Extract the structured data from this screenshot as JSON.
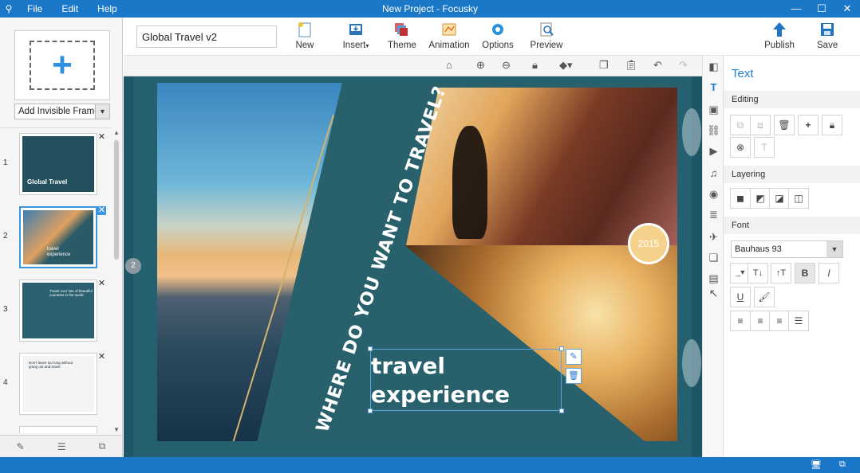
{
  "window": {
    "title": "New Project - Focusky",
    "menu": [
      "File",
      "Edit",
      "Help"
    ],
    "controls": [
      "—",
      "☐",
      "✕"
    ]
  },
  "left_panel": {
    "add_frame_icon": "plus-icon",
    "frame_select_value": "Add Invisible Frame",
    "thumbnails": [
      {
        "number": "1",
        "caption": "Global Travel"
      },
      {
        "number": "2",
        "caption": "travel experience"
      },
      {
        "number": "3",
        "caption": "Travel over lots of beautiful countries in the world"
      },
      {
        "number": "4",
        "caption": "Don't leave too long without going out and travel"
      }
    ]
  },
  "toolbar": {
    "project_title": "Global Travel v2",
    "buttons": [
      {
        "label": "New",
        "icon": "new-file-icon"
      },
      {
        "label": "Insert",
        "icon": "insert-icon"
      },
      {
        "label": "Theme",
        "icon": "theme-icon"
      },
      {
        "label": "Animation",
        "icon": "animation-icon"
      },
      {
        "label": "Options",
        "icon": "gear-icon"
      },
      {
        "label": "Preview",
        "icon": "preview-icon"
      },
      {
        "label": "Publish",
        "icon": "publish-icon"
      },
      {
        "label": "Save",
        "icon": "save-icon"
      }
    ]
  },
  "canvas": {
    "vertical_title": "WHERE DO YOU WANT TO TRAVEL?",
    "badge": "2015",
    "text_line1": "travel",
    "text_line2": "experience",
    "frame_marker": "2"
  },
  "right_panel": {
    "title": "Text",
    "editing_label": "Editing",
    "layering_label": "Layering",
    "font_label": "Font",
    "font_value": "Bauhaus 93",
    "bold_label": "B",
    "italic_label": "I",
    "underline_label": "U"
  },
  "colors": {
    "accent": "#1b78c8",
    "canvas_bg": "#1f5666",
    "slide_bg": "#28606c"
  }
}
